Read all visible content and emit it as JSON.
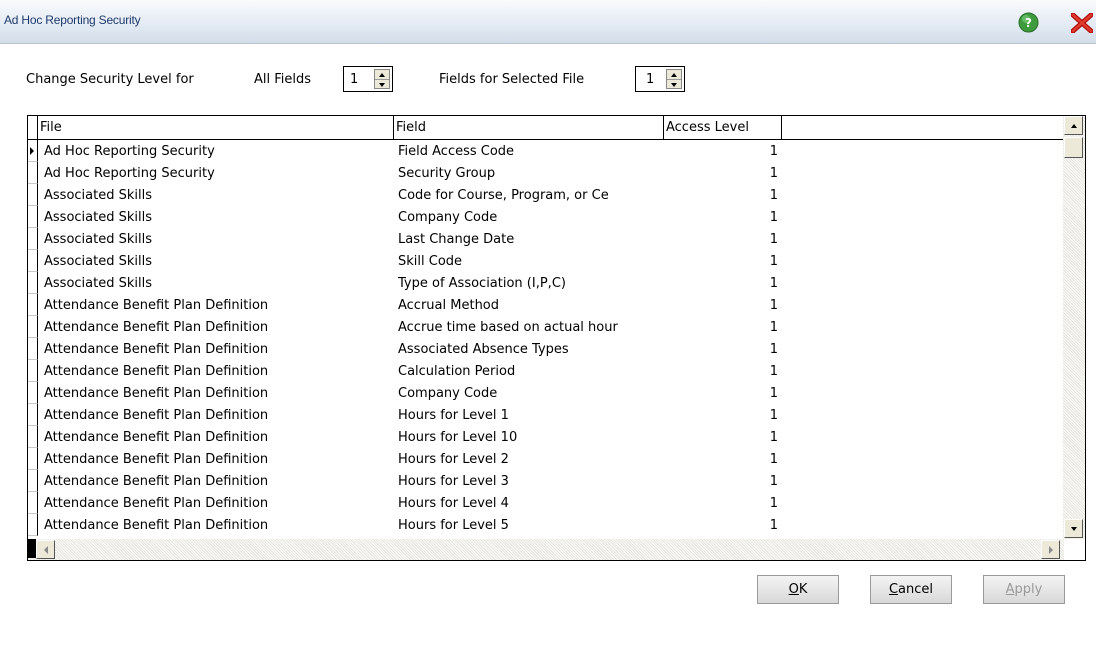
{
  "window": {
    "title": "Ad Hoc Reporting Security"
  },
  "icons": {
    "help": "help-icon",
    "close": "close-icon"
  },
  "controls": {
    "change_label": "Change Security Level for",
    "all_fields_label": "All Fields",
    "all_fields_value": "1",
    "selected_file_label": "Fields for Selected File",
    "selected_file_value": "1"
  },
  "table": {
    "columns": [
      "File",
      "Field",
      "Access Level"
    ],
    "rows": [
      {
        "file": "Ad Hoc Reporting Security",
        "field": "Field Access Code",
        "level": "1"
      },
      {
        "file": "Ad Hoc Reporting Security",
        "field": "Security Group",
        "level": "1"
      },
      {
        "file": "Associated Skills",
        "field": "Code for Course, Program, or Ce",
        "level": "1"
      },
      {
        "file": "Associated Skills",
        "field": "Company Code",
        "level": "1"
      },
      {
        "file": "Associated Skills",
        "field": "Last Change Date",
        "level": "1"
      },
      {
        "file": "Associated Skills",
        "field": "Skill Code",
        "level": "1"
      },
      {
        "file": "Associated Skills",
        "field": "Type of Association (I,P,C)",
        "level": "1"
      },
      {
        "file": "Attendance Benefit Plan Definition",
        "field": "Accrual Method",
        "level": "1"
      },
      {
        "file": "Attendance Benefit Plan Definition",
        "field": "Accrue time based on actual hour",
        "level": "1"
      },
      {
        "file": "Attendance Benefit Plan Definition",
        "field": "Associated Absence Types",
        "level": "1"
      },
      {
        "file": "Attendance Benefit Plan Definition",
        "field": "Calculation Period",
        "level": "1"
      },
      {
        "file": "Attendance Benefit Plan Definition",
        "field": "Company Code",
        "level": "1"
      },
      {
        "file": "Attendance Benefit Plan Definition",
        "field": "Hours for Level 1",
        "level": "1"
      },
      {
        "file": "Attendance Benefit Plan Definition",
        "field": "Hours for Level 10",
        "level": "1"
      },
      {
        "file": "Attendance Benefit Plan Definition",
        "field": "Hours for Level 2",
        "level": "1"
      },
      {
        "file": "Attendance Benefit Plan Definition",
        "field": "Hours for Level 3",
        "level": "1"
      },
      {
        "file": "Attendance Benefit Plan Definition",
        "field": "Hours for Level 4",
        "level": "1"
      },
      {
        "file": "Attendance Benefit Plan Definition",
        "field": "Hours for Level 5",
        "level": "1"
      }
    ],
    "selected_row": 0
  },
  "buttons": {
    "ok_mnemonic": "O",
    "ok_rest": "K",
    "cancel_mnemonic": "C",
    "cancel_rest": "ancel",
    "apply_mnemonic": "A",
    "apply_rest": "pply"
  }
}
